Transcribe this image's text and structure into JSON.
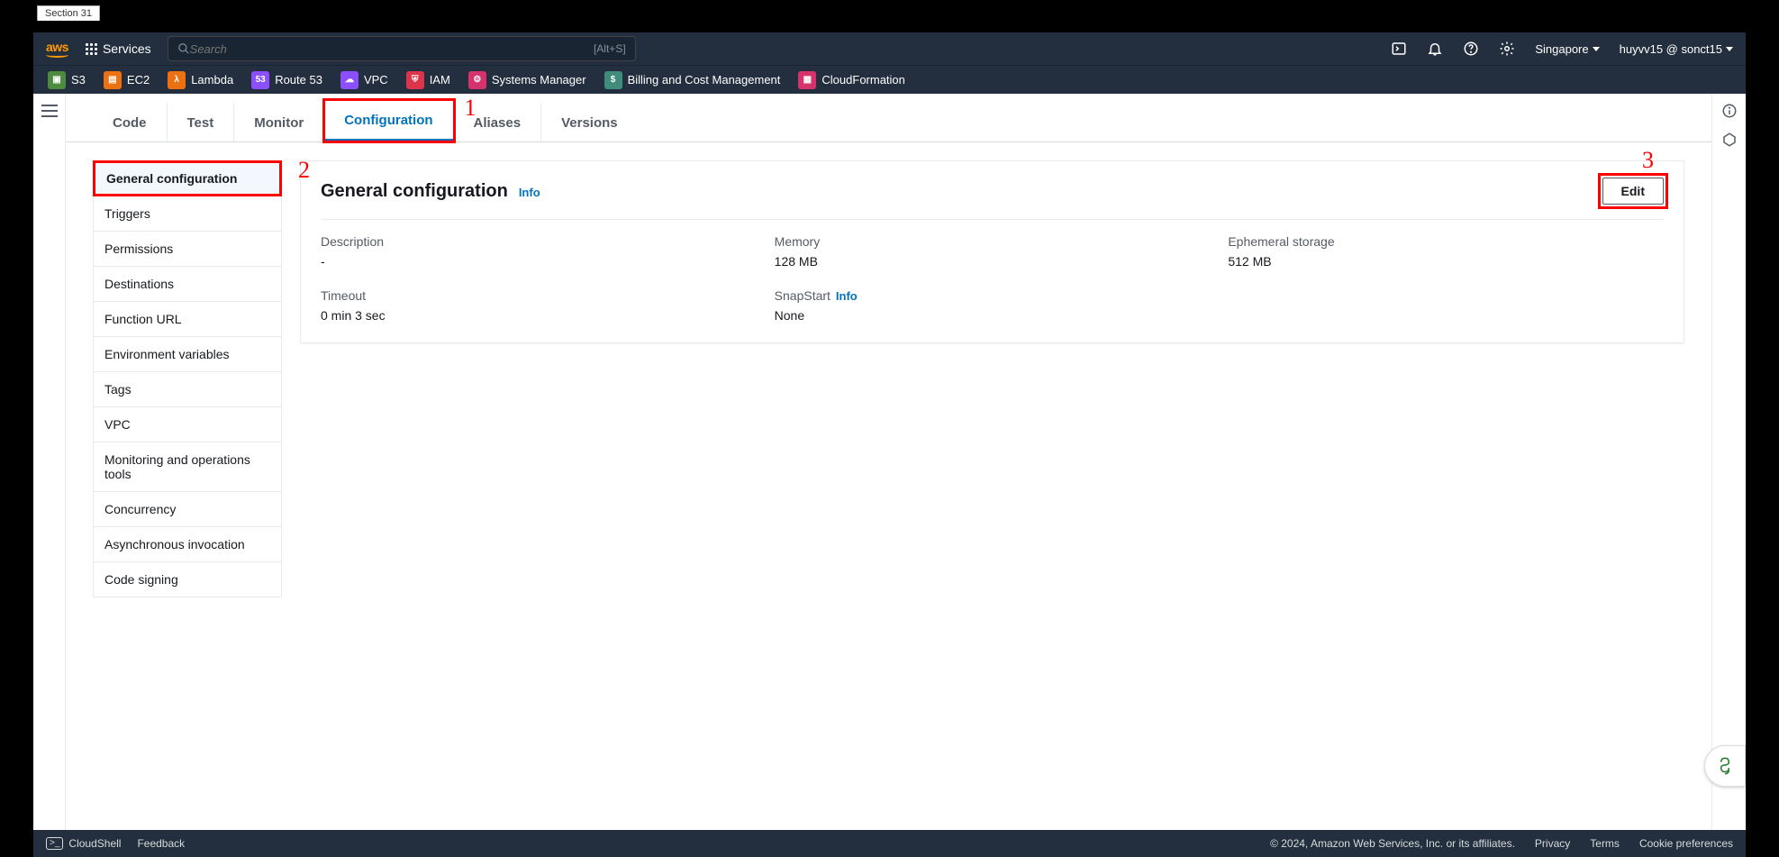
{
  "section_tab": "Section 31",
  "topnav": {
    "logo": "aws",
    "services_label": "Services",
    "search_placeholder": "Search",
    "search_hint": "[Alt+S]",
    "region": "Singapore",
    "account": "huyvv15 @ sonct15"
  },
  "svcbar": [
    {
      "label": "S3",
      "color": "bg-green"
    },
    {
      "label": "EC2",
      "color": "bg-orange"
    },
    {
      "label": "Lambda",
      "color": "bg-orange"
    },
    {
      "label": "Route 53",
      "color": "bg-purple"
    },
    {
      "label": "VPC",
      "color": "bg-purple"
    },
    {
      "label": "IAM",
      "color": "bg-red"
    },
    {
      "label": "Systems Manager",
      "color": "bg-pink"
    },
    {
      "label": "Billing and Cost Management",
      "color": "bg-teal"
    },
    {
      "label": "CloudFormation",
      "color": "bg-pink"
    }
  ],
  "tabs": [
    "Code",
    "Test",
    "Monitor",
    "Configuration",
    "Aliases",
    "Versions"
  ],
  "active_tab": "Configuration",
  "sidenav": [
    "General configuration",
    "Triggers",
    "Permissions",
    "Destinations",
    "Function URL",
    "Environment variables",
    "Tags",
    "VPC",
    "Monitoring and operations tools",
    "Concurrency",
    "Asynchronous invocation",
    "Code signing"
  ],
  "active_sidenav": "General configuration",
  "panel": {
    "title": "General configuration",
    "info": "Info",
    "edit_label": "Edit",
    "fields": {
      "description": {
        "label": "Description",
        "value": "-"
      },
      "memory": {
        "label": "Memory",
        "value": "128  MB"
      },
      "ephemeral": {
        "label": "Ephemeral storage",
        "value": "512  MB"
      },
      "timeout": {
        "label": "Timeout",
        "value": "0  min   3  sec"
      },
      "snapstart": {
        "label": "SnapStart",
        "value": "None",
        "info": "Info"
      }
    }
  },
  "footer": {
    "cloudshell": "CloudShell",
    "feedback": "Feedback",
    "copyright": "© 2024, Amazon Web Services, Inc. or its affiliates.",
    "links": [
      "Privacy",
      "Terms",
      "Cookie preferences"
    ]
  },
  "annotations": {
    "1": "1",
    "2": "2",
    "3": "3"
  }
}
